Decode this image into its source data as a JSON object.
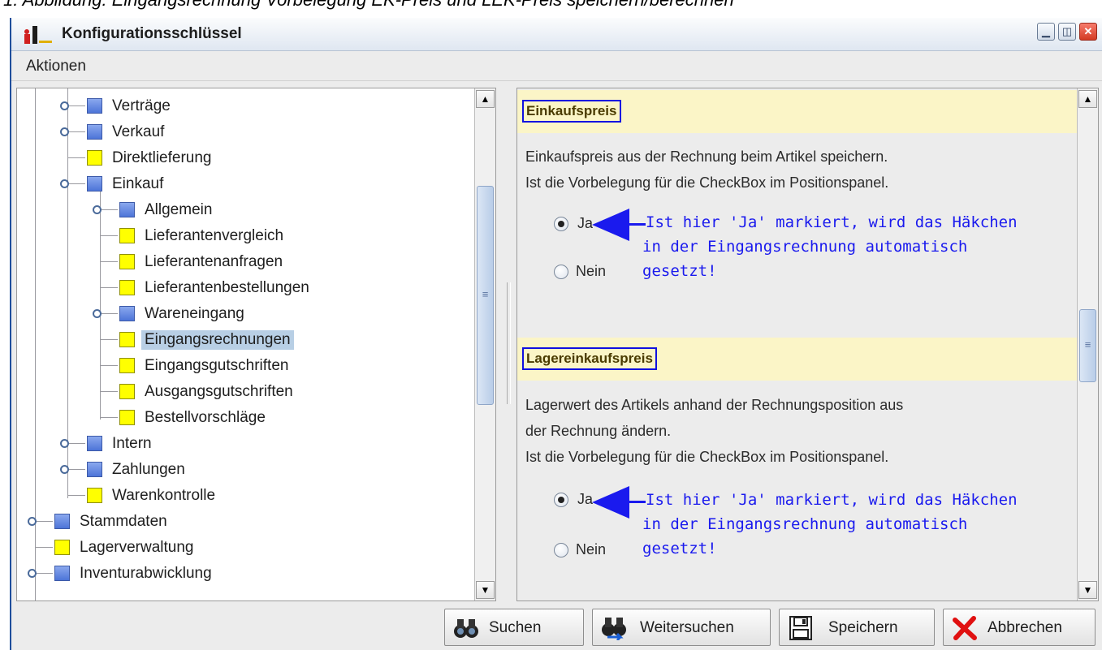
{
  "caption": "1: Abbildung: Eingangsrechnung Vorbelegung EK-Preis und LEK-Preis speichern/berechnen",
  "window": {
    "title": "Konfigurationsschlüssel"
  },
  "menu": {
    "items": [
      "Aktionen"
    ]
  },
  "tree": {
    "items": [
      {
        "label": "Verträge",
        "color": "blue"
      },
      {
        "label": "Verkauf",
        "color": "blue"
      },
      {
        "label": "Direktlieferung",
        "color": "yellow"
      },
      {
        "label": "Einkauf",
        "color": "blue"
      },
      {
        "label": "Allgemein",
        "color": "blue"
      },
      {
        "label": "Lieferantenvergleich",
        "color": "yellow"
      },
      {
        "label": "Lieferantenanfragen",
        "color": "yellow"
      },
      {
        "label": "Lieferantenbestellungen",
        "color": "yellow"
      },
      {
        "label": "Wareneingang",
        "color": "blue"
      },
      {
        "label": "Eingangsrechnungen",
        "color": "yellow",
        "selected": true
      },
      {
        "label": "Eingangsgutschriften",
        "color": "yellow"
      },
      {
        "label": "Ausgangsgutschriften",
        "color": "yellow"
      },
      {
        "label": "Bestellvorschläge",
        "color": "yellow"
      },
      {
        "label": "Intern",
        "color": "blue"
      },
      {
        "label": "Zahlungen",
        "color": "blue"
      },
      {
        "label": "Warenkontrolle",
        "color": "yellow"
      },
      {
        "label": "Stammdaten",
        "color": "blue"
      },
      {
        "label": "Lagerverwaltung",
        "color": "yellow"
      },
      {
        "label": "Inventurabwicklung",
        "color": "blue"
      }
    ]
  },
  "sections": [
    {
      "title": "Einkaufspreis",
      "desc1": "Einkaufspreis aus der Rechnung beim Artikel speichern.",
      "desc2": "Ist die Vorbelegung für die CheckBox im Positionspanel.",
      "opt_yes": "Ja",
      "opt_no": "Nein",
      "selected": "Ja",
      "note1": "Ist hier 'Ja' markiert, wird das Häkchen",
      "note2": "in der Eingangsrechnung automatisch",
      "note3": "gesetzt!"
    },
    {
      "title": "Lagereinkaufspreis",
      "desc1": "Lagerwert des Artikels anhand der Rechnungsposition aus",
      "desc2": "der Rechnung ändern.",
      "desc3": "Ist die Vorbelegung für die CheckBox im Positionspanel.",
      "opt_yes": "Ja",
      "opt_no": "Nein",
      "selected": "Ja",
      "note1": "Ist hier 'Ja' markiert, wird das Häkchen",
      "note2": "in der Eingangsrechnung automatisch",
      "note3": "gesetzt!"
    }
  ],
  "buttons": {
    "search": "Suchen",
    "search_next": "Weitersuchen",
    "save": "Speichern",
    "cancel": "Abbrechen"
  },
  "colors": {
    "annotation": "#1a1aee",
    "section_header": "#fbf5c7",
    "selection": "#b8cfe5"
  }
}
